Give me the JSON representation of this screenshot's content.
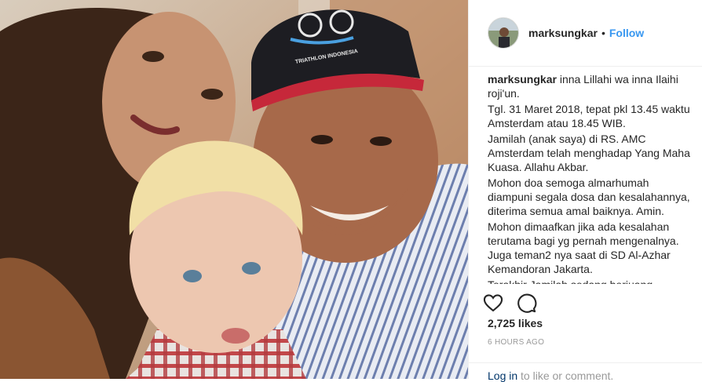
{
  "post": {
    "username": "marksungkar",
    "separator": "•",
    "follow_label": "Follow",
    "caption_username": "marksungkar",
    "caption_lines": [
      "inna Lillahi wa inna Ilaihi roji'un.",
      "Tgl. 31 Maret 2018, tepat pkl 13.45 waktu Amsterdam atau 18.45 WIB.",
      "Jamilah (anak saya) di RS. AMC Amsterdam telah menghadap Yang Maha Kuasa. Allahu Akbar.",
      "Mohon doa semoga almarhumah diampuni segala dosa dan kesalahannya, diterima semua amal baiknya. Amin.",
      "Mohon dimaafkan jika ada kesalahan terutama bagi yg pernah mengenalnya. Juga teman2 nya saat di SD Al-Azhar Kemandoran Jakarta.",
      "Terakhir Jamilah sedang berjuang sebagai"
    ],
    "likes": "2,725 likes",
    "time_ago": "6 HOURS AGO",
    "login_link": "Log in",
    "login_rest": "to like or comment.",
    "cap_text": "TRIATHLON INDONESIA",
    "icons": {
      "like": "heart-icon",
      "comment": "comment-icon"
    },
    "colors": {
      "accent": "#3897f0",
      "muted": "#999999",
      "text": "#262626"
    }
  }
}
